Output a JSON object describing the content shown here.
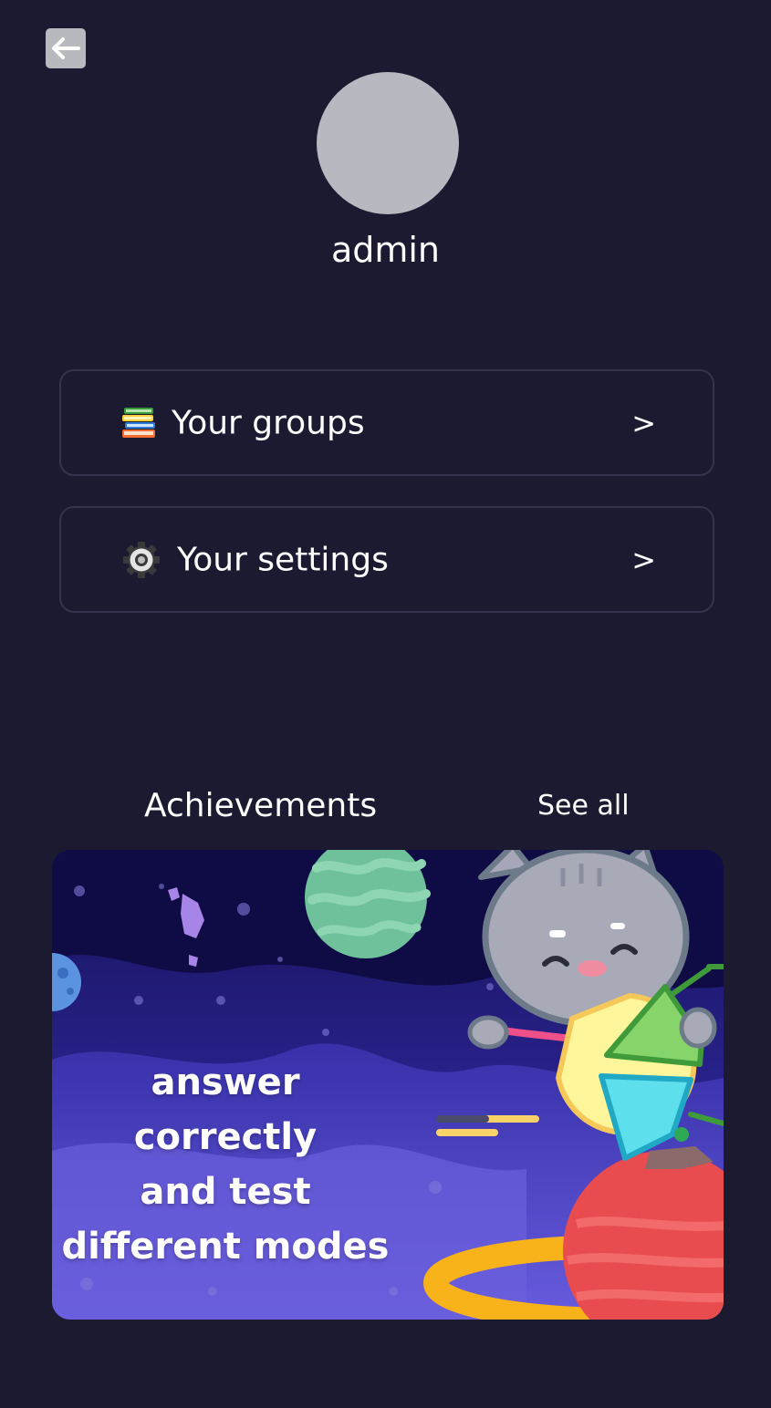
{
  "header": {
    "back_icon": "arrow-left-icon"
  },
  "profile": {
    "username": "admin",
    "avatar_color": "#b8b8c0"
  },
  "menu": {
    "groups": {
      "icon": "books-icon",
      "label": "Your groups",
      "chevron": ">"
    },
    "settings": {
      "icon": "gear-icon",
      "label": "Your settings",
      "chevron": ">"
    }
  },
  "achievements": {
    "title": "Achievements",
    "see_all": "See all",
    "banner": {
      "lines": [
        "answer",
        "correctly",
        "and test",
        "different modes"
      ]
    }
  },
  "colors": {
    "background": "#1b1a31",
    "card_border": "#34344e",
    "text": "#ffffff"
  }
}
